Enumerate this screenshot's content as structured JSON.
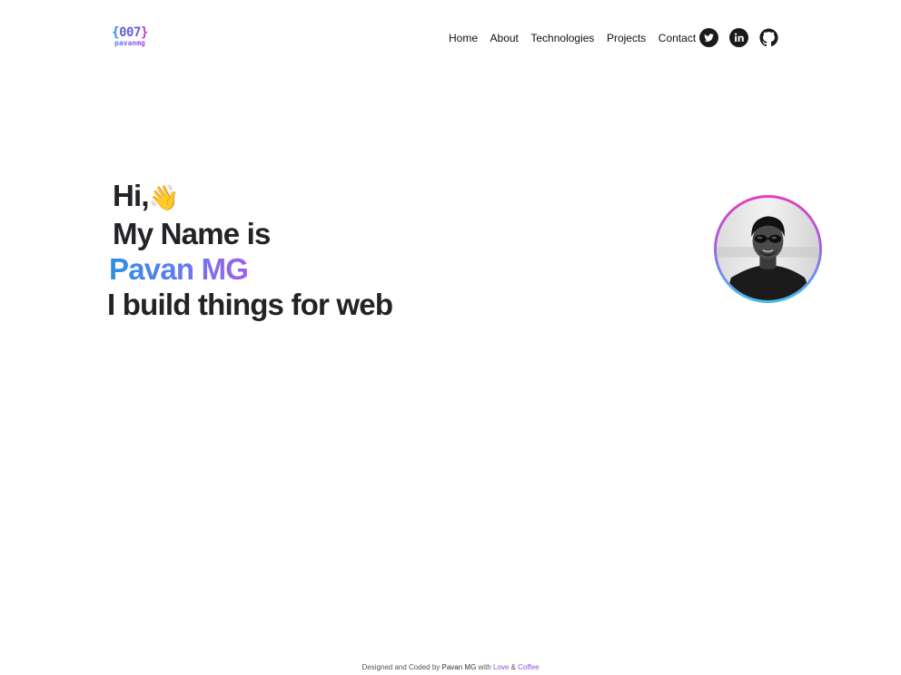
{
  "header": {
    "logo": {
      "brace_open": "{",
      "number": "007",
      "brace_close": "}",
      "subtitle": "pavanmg"
    },
    "nav": [
      {
        "label": "Home"
      },
      {
        "label": "About"
      },
      {
        "label": "Technologies"
      },
      {
        "label": "Projects"
      },
      {
        "label": "Contact"
      }
    ],
    "socials": [
      {
        "name": "twitter-icon"
      },
      {
        "name": "linkedin-icon"
      },
      {
        "name": "github-icon"
      }
    ]
  },
  "hero": {
    "greeting": "Hi,",
    "wave_emoji": "👋",
    "intro": "My Name is",
    "name": "Pavan MG",
    "tagline": "I build things for web"
  },
  "avatar": {
    "alt": "Profile photo of Pavan MG"
  },
  "footer": {
    "prefix": "Designed and Coded by ",
    "author": "Pavan MG",
    "with": " with ",
    "love": "Love",
    "amp": " & ",
    "coffee": "Coffee"
  },
  "colors": {
    "text": "#222326",
    "gradient_start": "#2e8fe3",
    "gradient_end": "#a35ee8",
    "ring_top": "#e040c0",
    "ring_bottom": "#3cc0ee"
  }
}
